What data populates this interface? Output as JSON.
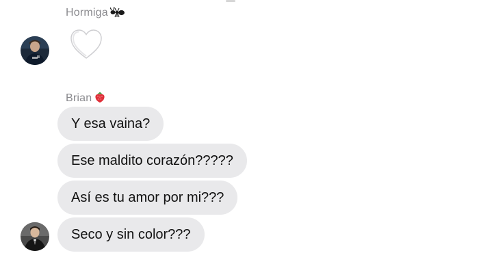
{
  "chat": {
    "groups": [
      {
        "sender": "Hormiga",
        "sender_emoji": "🐜",
        "sender_emoji_name": "ant-emoji",
        "messages": [
          {
            "type": "emoji",
            "content": "🤍",
            "icon": "white-heart-icon",
            "color": "#ffffff"
          }
        ]
      },
      {
        "sender": "Brian",
        "sender_emoji": "🍓",
        "sender_emoji_name": "strawberry-emoji",
        "messages": [
          {
            "type": "text",
            "content": "Y esa vaina?"
          },
          {
            "type": "text",
            "content": "Ese maldito corazón?????"
          },
          {
            "type": "text",
            "content": "Así es tu amor por mi???"
          },
          {
            "type": "text",
            "content": "Seco y sin color???"
          }
        ]
      }
    ]
  },
  "colors": {
    "bubble_background": "#e9e9eb",
    "message_text": "#111111",
    "sender_name": "#8a8a8e",
    "background": "#ffffff"
  }
}
